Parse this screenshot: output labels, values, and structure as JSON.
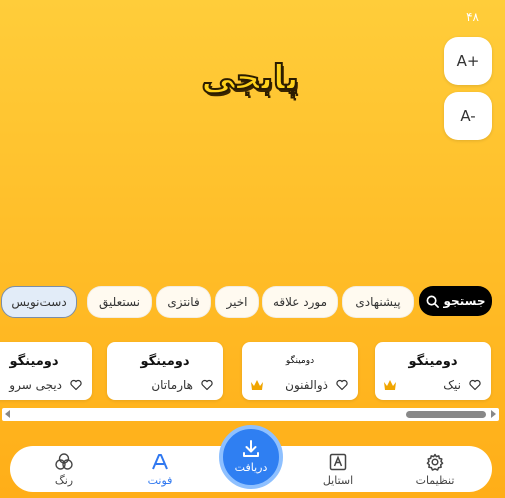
{
  "status": {
    "counter": "۴۸"
  },
  "preview": {
    "text": "پابجی"
  },
  "size_controls": {
    "increase": "A+",
    "decrease": "A-"
  },
  "filters": {
    "search": "جستجو",
    "items": [
      "پیشنهادی",
      "مورد علاقه",
      "اخیر",
      "فانتزی",
      "نستعلیق",
      "دست‌نویس"
    ],
    "selected": "دست‌نویس"
  },
  "fonts": [
    {
      "sample": "دومینگو",
      "name": "نیک",
      "premium": true
    },
    {
      "sample": "دومینگو",
      "name": "ذوالفنون",
      "premium": true
    },
    {
      "sample": "دومینگو",
      "name": "هارماتان",
      "premium": false
    },
    {
      "sample": "دومینگو",
      "name": "دیجی سرو",
      "premium": false
    }
  ],
  "nav": {
    "settings": "تنظیمات",
    "style": "استایل",
    "download": "دریافت",
    "font": "فونت",
    "color": "رنگ",
    "active": "font"
  },
  "colors": {
    "accent": "#2f7ff2",
    "background": "#ffbf2a",
    "premium": "#f0a500"
  }
}
